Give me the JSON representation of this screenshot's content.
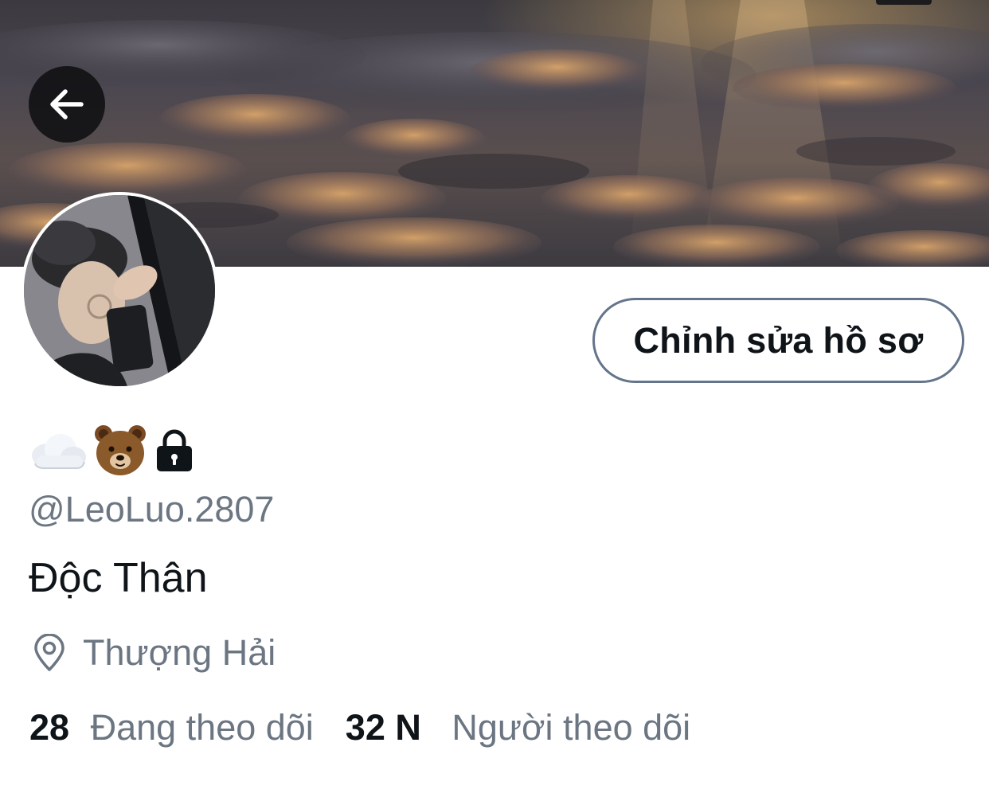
{
  "profile": {
    "emoji_badges": [
      "cloud-emoji",
      "bear-emoji",
      "lock-icon"
    ],
    "handle": "@LeoLuo.2807",
    "bio": "Độc Thân",
    "location": "Thượng Hải",
    "following_count": "28",
    "following_label": "Đang theo dõi",
    "followers_count": "32 N",
    "followers_label": "Người theo dõi"
  },
  "actions": {
    "edit_profile_label": "Chỉnh sửa hồ sơ",
    "back_icon": "arrow-left-icon"
  },
  "colors": {
    "text_primary": "#0f1419",
    "text_secondary": "#6b7682",
    "button_border": "#64748a"
  }
}
